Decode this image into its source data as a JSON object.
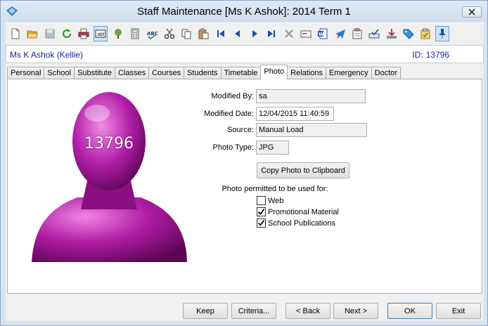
{
  "window": {
    "title": "Staff Maintenance  [Ms K Ashok]:  2014 Term 1"
  },
  "toolbar": {
    "icons": [
      "new-icon",
      "open-folder-icon",
      "save-icon",
      "refresh-icon",
      "print-icon",
      "text-field-icon",
      "tree-icon",
      "calculator-icon",
      "spellcheck-icon",
      "cut-icon",
      "copy-icon",
      "paste-icon",
      "first-record-icon",
      "previous-record-icon",
      "next-record-icon",
      "last-record-icon",
      "delete-icon",
      "card-icon",
      "word-icon",
      "send-icon",
      "clipboard-icon",
      "approve-icon",
      "download-icon",
      "tag-icon",
      "checklist-icon",
      "pin-icon"
    ]
  },
  "staff": {
    "name": "Ms K Ashok (Kellie)",
    "id_label": "ID:",
    "id": "13796"
  },
  "tabs": [
    "Personal",
    "School",
    "Substitute",
    "Classes",
    "Courses",
    "Students",
    "Timetable",
    "Photo",
    "Relations",
    "Emergency",
    "Doctor"
  ],
  "active_tab": "Photo",
  "photo": {
    "overlay_id": "13796"
  },
  "form": {
    "modified_by_label": "Modified By:",
    "modified_by": "sa",
    "modified_date_label": "Modified Date:",
    "modified_date": "12/04/2015 11:40:59",
    "source_label": "Source:",
    "source": "Manual Load",
    "photo_type_label": "Photo Type:",
    "photo_type": "JPG",
    "copy_button": "Copy Photo to Clipboard",
    "permitted_label": "Photo permitted to be used for:",
    "options": [
      {
        "label": "Web",
        "checked": false
      },
      {
        "label": "Promotional Material",
        "checked": true
      },
      {
        "label": "School Publications",
        "checked": true
      }
    ]
  },
  "footer": {
    "keep": "Keep",
    "criteria": "Criteria...",
    "back": "< Back",
    "next": "Next >",
    "ok": "OK",
    "exit": "Exit"
  }
}
